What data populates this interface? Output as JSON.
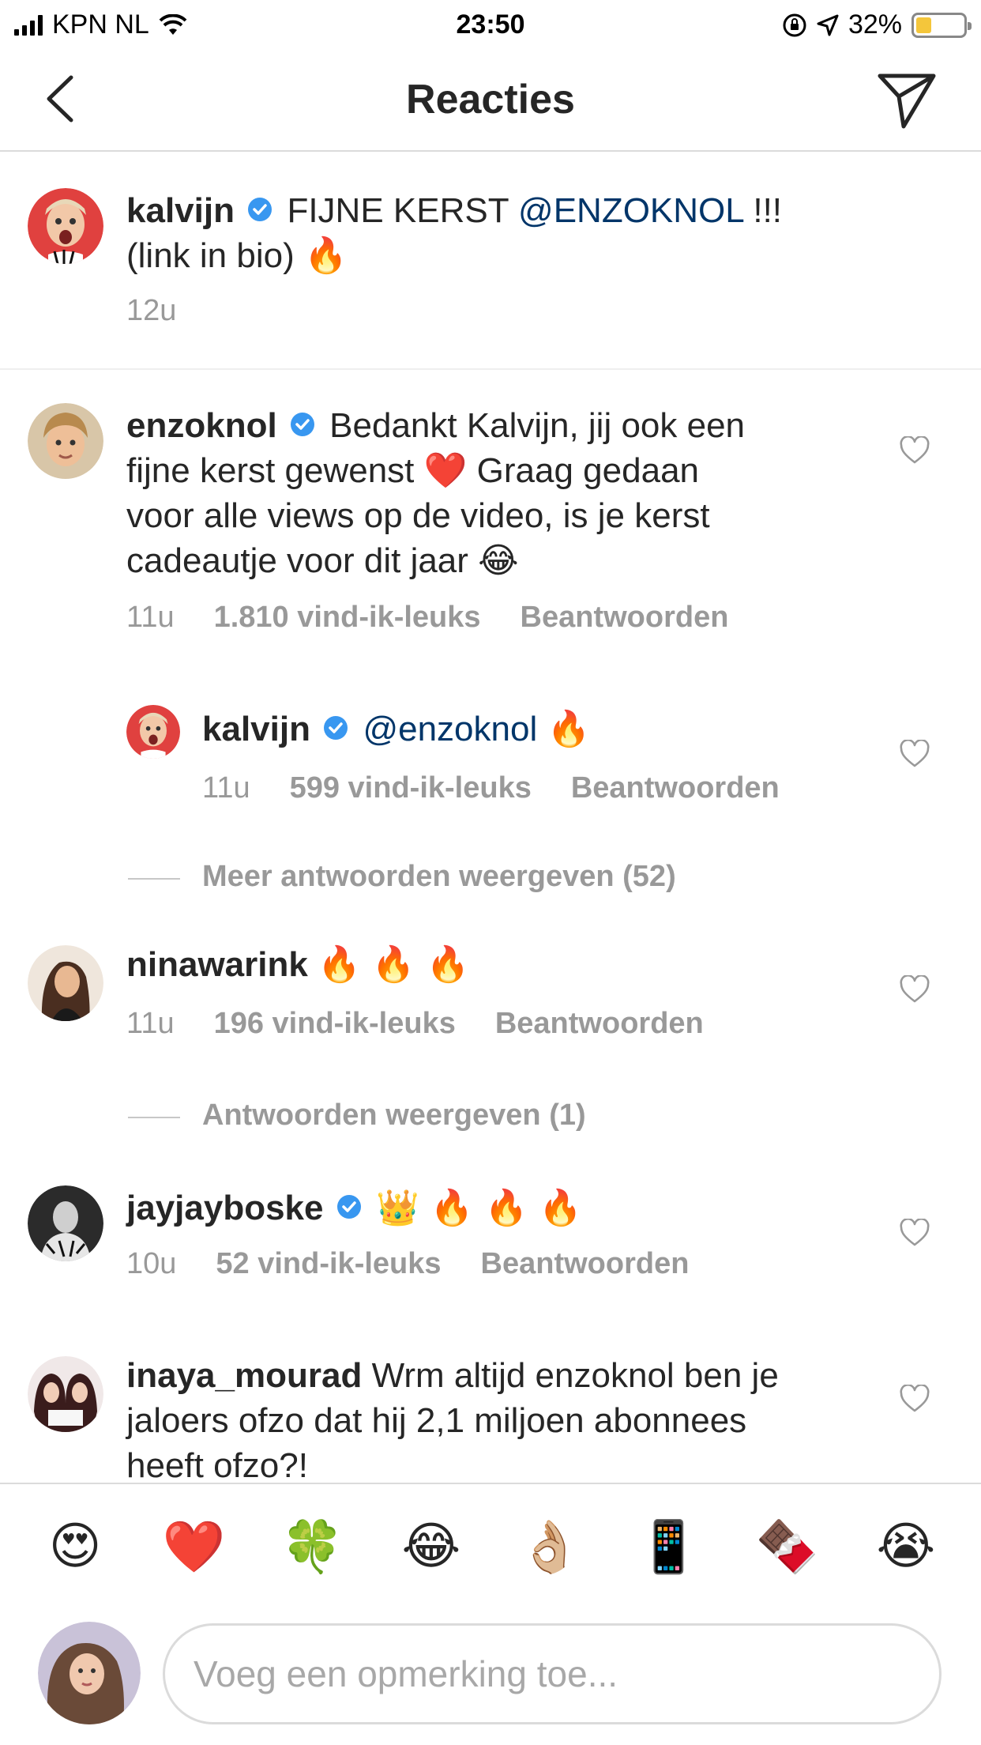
{
  "status_bar": {
    "carrier": "KPN NL",
    "time": "23:50",
    "battery": "32%",
    "battery_level": 0.32
  },
  "header": {
    "title": "Reacties",
    "back_icon": "chevron-left-icon",
    "send_icon": "paper-plane-icon"
  },
  "caption": {
    "username": "kalvijn",
    "text_before": "FIJNE KERST",
    "mention": "@ENZOKNOL",
    "text_after": "!!!",
    "line2": "(link in bio)",
    "emoji": "🔥",
    "time": "12u"
  },
  "comments": [
    {
      "username": "enzoknol",
      "lines": [
        "Bedankt Kalvijn, jij ook een",
        "fijne kerst gewenst",
        "Graag gedaan",
        "voor alle views op de video, is je kerst",
        "cadeautje voor dit jaar"
      ],
      "emoji_heart": "❤️",
      "emoji_laugh": "😂",
      "time": "11u",
      "likes": "1.810 vind-ik-leuks",
      "reply": "Beantwoorden"
    },
    {
      "username": "kalvijn",
      "mention": "@enzoknol",
      "emoji": "🔥",
      "time": "11u",
      "likes": "599 vind-ik-leuks",
      "reply": "Beantwoorden"
    },
    {
      "username": "ninawarink",
      "emoji": "🔥 🔥 🔥",
      "time": "11u",
      "likes": "196 vind-ik-leuks",
      "reply": "Beantwoorden"
    },
    {
      "username": "jayjayboske",
      "emoji": "👑 🔥 🔥 🔥",
      "time": "10u",
      "likes": "52 vind-ik-leuks",
      "reply": "Beantwoorden"
    },
    {
      "username": "inaya_mourad",
      "lines": [
        "Wrm altijd enzoknol ben je",
        "jaloers ofzo dat hij 2,1 miljoen abonnees",
        "heeft ofzo?!"
      ]
    }
  ],
  "more_replies": {
    "first": "Meer antwoorden weergeven (52)",
    "second": "Antwoorden weergeven (1)"
  },
  "emoji_bar": [
    "😍",
    "❤️",
    "🍀",
    "😂",
    "👌🏼",
    "📱",
    "🍫",
    "😭"
  ],
  "input": {
    "placeholder": "Voeg een opmerking toe..."
  },
  "colors": {
    "mention": "#003569",
    "verified": "#3897f0",
    "meta": "#999999",
    "battery_fill": "#f4c63b"
  }
}
